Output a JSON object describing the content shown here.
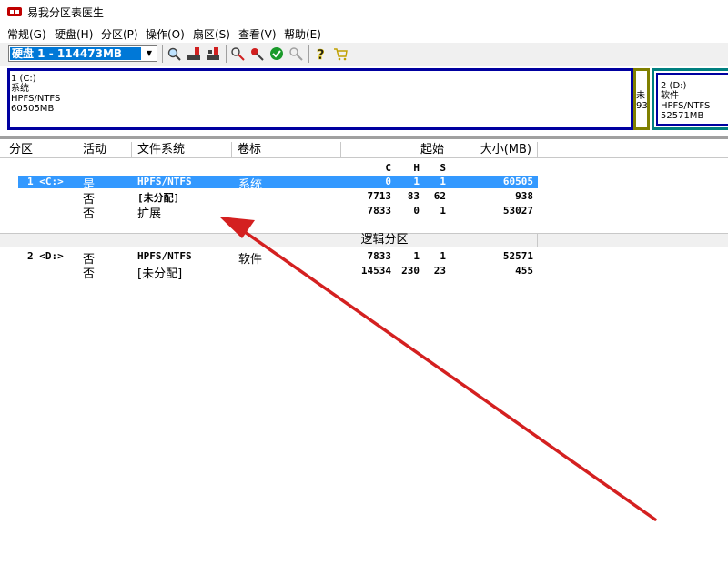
{
  "window": {
    "title": "易我分区表医生"
  },
  "menu": [
    "常规(G)",
    "硬盘(H)",
    "分区(P)",
    "操作(O)",
    "扇区(S)",
    "查看(V)",
    "帮助(E)"
  ],
  "toolbar": {
    "disk_selected": "硬盘 1 - 114473MB",
    "icons": [
      "search-disk-icon",
      "edit-partition-icon",
      "edit-partition2-icon",
      "wand-icon",
      "tool-icon",
      "apply-check-icon",
      "undo-icon",
      "help-icon",
      "cart-icon"
    ]
  },
  "diskmap": {
    "c": {
      "line1": "1 (C:)",
      "line2": "系统",
      "line3": "HPFS/NTFS",
      "line4": "60505MB"
    },
    "unalloc": {
      "line1": "未",
      "line2": "93"
    },
    "d": {
      "line1": "2 (D:)",
      "line2": "软件",
      "line3": "HPFS/NTFS",
      "line4": "52571MB"
    }
  },
  "table": {
    "headers": {
      "partition": "分区",
      "active": "活动",
      "fs": "文件系统",
      "label": "卷标",
      "start": "起始",
      "size": "大小(MB)"
    },
    "subheaders": {
      "c": "C",
      "h": "H",
      "s": "S"
    },
    "primary_rows": [
      {
        "part": "1 <C:>",
        "active": "是",
        "fs": "HPFS/NTFS",
        "label": "系统",
        "c": "0",
        "h": "1",
        "s": "1",
        "size": "60505"
      },
      {
        "part": "",
        "active": "否",
        "fs": "[未分配]",
        "label": "",
        "c": "7713",
        "h": "83",
        "s": "62",
        "size": "938"
      },
      {
        "part": "",
        "active": "否",
        "fs": "扩展",
        "label": "",
        "c": "7833",
        "h": "0",
        "s": "1",
        "size": "53027"
      }
    ],
    "logical_label": "逻辑分区",
    "logical_rows": [
      {
        "part": "2 <D:>",
        "active": "否",
        "fs": "HPFS/NTFS",
        "label": "软件",
        "c": "7833",
        "h": "1",
        "s": "1",
        "size": "52571"
      },
      {
        "part": "",
        "active": "否",
        "fs": "[未分配]",
        "label": "",
        "c": "14534",
        "h": "230",
        "s": "23",
        "size": "455"
      }
    ]
  },
  "colors": {
    "selection": "#3399ff",
    "arrow": "#d42020",
    "c_border": "#0000a0",
    "unalloc_border": "#808000",
    "d_border": "#008080"
  }
}
